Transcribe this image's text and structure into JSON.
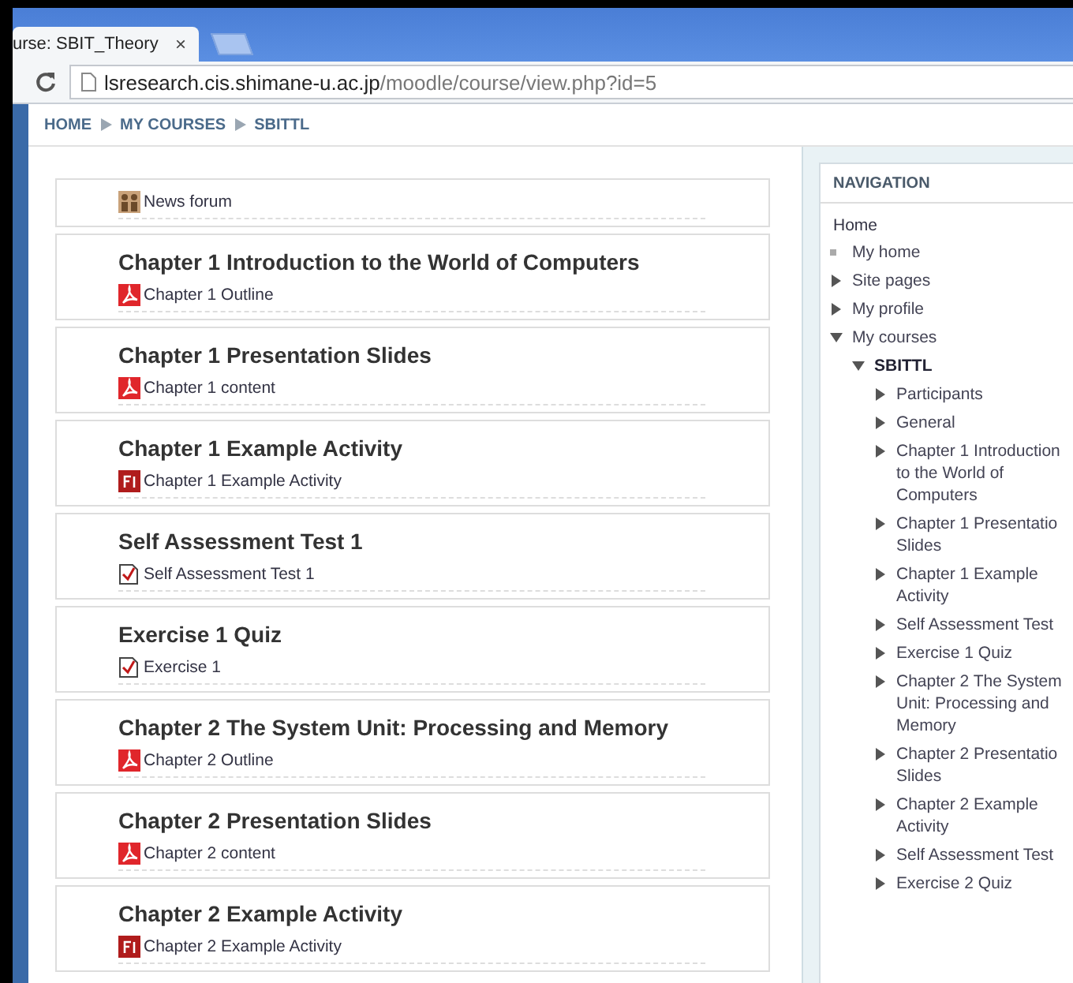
{
  "browser": {
    "tab_title": "urse: SBIT_Theory",
    "tab_close": "×",
    "url_host": "lsresearch.cis.shimane-u.ac.jp",
    "url_path": "/moodle/course/view.php?id=5"
  },
  "breadcrumb": [
    "HOME",
    "MY COURSES",
    "SBITTL"
  ],
  "sections": [
    {
      "activity": {
        "kind": "forum",
        "label": "News forum"
      }
    },
    {
      "title": "Chapter 1 Introduction to the World of Computers",
      "activity": {
        "kind": "pdf",
        "label": "Chapter 1 Outline"
      }
    },
    {
      "title": "Chapter 1 Presentation Slides",
      "activity": {
        "kind": "pdf",
        "label": "Chapter 1 content"
      }
    },
    {
      "title": "Chapter 1 Example Activity",
      "activity": {
        "kind": "flash",
        "label": "Chapter 1 Example Activity"
      }
    },
    {
      "title": "Self Assessment Test 1",
      "activity": {
        "kind": "quiz",
        "label": "Self Assessment Test 1"
      }
    },
    {
      "title": "Exercise 1 Quiz",
      "activity": {
        "kind": "quiz",
        "label": "Exercise 1"
      }
    },
    {
      "title": "Chapter 2 The System Unit: Processing and Memory",
      "activity": {
        "kind": "pdf",
        "label": "Chapter 2 Outline"
      }
    },
    {
      "title": "Chapter 2 Presentation Slides",
      "activity": {
        "kind": "pdf",
        "label": "Chapter 2 content"
      }
    },
    {
      "title": "Chapter 2 Example Activity",
      "activity": {
        "kind": "flash",
        "label": "Chapter 2 Example Activity"
      }
    }
  ],
  "navigation": {
    "title": "NAVIGATION",
    "home": "Home",
    "items": [
      {
        "label": "My home",
        "kind": "leaf"
      },
      {
        "label": "Site pages",
        "kind": "branch",
        "expanded": false
      },
      {
        "label": "My profile",
        "kind": "branch",
        "expanded": false
      },
      {
        "label": "My courses",
        "kind": "branch",
        "expanded": true,
        "children": [
          {
            "label": "SBITTL",
            "kind": "course",
            "expanded": true,
            "children": [
              {
                "label": "Participants",
                "kind": "branch",
                "expanded": false
              },
              {
                "label": "General",
                "kind": "branch",
                "expanded": false
              },
              {
                "label": "Chapter 1 Introduction to the World of Computers",
                "kind": "branch",
                "expanded": false
              },
              {
                "label": "Chapter 1 Presentatio Slides",
                "kind": "branch",
                "expanded": false
              },
              {
                "label": "Chapter 1 Example Activity",
                "kind": "branch",
                "expanded": false
              },
              {
                "label": "Self Assessment Test",
                "kind": "branch",
                "expanded": false
              },
              {
                "label": "Exercise 1 Quiz",
                "kind": "branch",
                "expanded": false
              },
              {
                "label": "Chapter 2 The System Unit: Processing and Memory",
                "kind": "branch",
                "expanded": false
              },
              {
                "label": "Chapter 2 Presentatio Slides",
                "kind": "branch",
                "expanded": false
              },
              {
                "label": "Chapter 2 Example Activity",
                "kind": "branch",
                "expanded": false
              },
              {
                "label": "Self Assessment Test",
                "kind": "branch",
                "expanded": false
              },
              {
                "label": "Exercise 2 Quiz",
                "kind": "branch",
                "expanded": false
              }
            ]
          }
        ]
      }
    ]
  }
}
